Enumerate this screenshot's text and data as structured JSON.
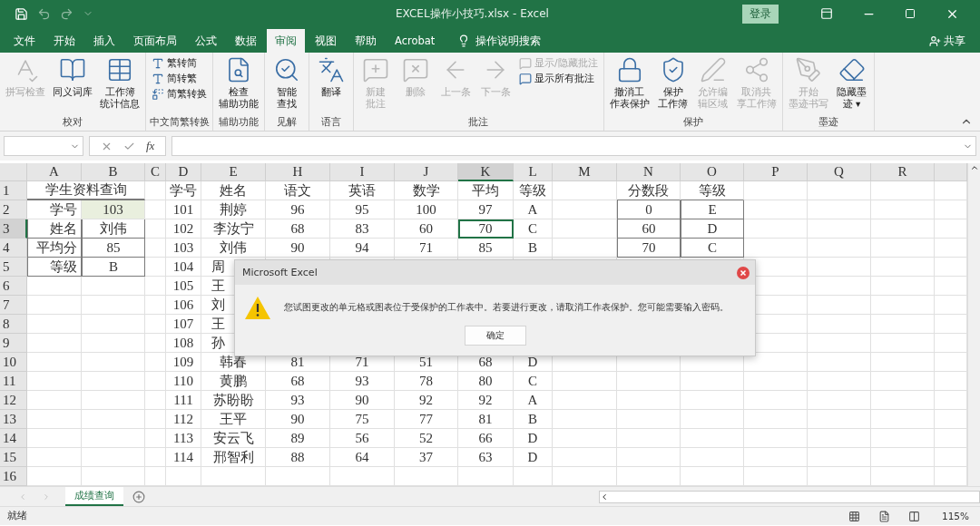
{
  "window": {
    "title": "EXCEL操作小技巧.xlsx  -  Excel",
    "login": "登录"
  },
  "menu_tabs": [
    {
      "label": "文件",
      "selected": false
    },
    {
      "label": "开始",
      "selected": false
    },
    {
      "label": "插入",
      "selected": false
    },
    {
      "label": "页面布局",
      "selected": false
    },
    {
      "label": "公式",
      "selected": false
    },
    {
      "label": "数据",
      "selected": false
    },
    {
      "label": "审阅",
      "selected": true
    },
    {
      "label": "视图",
      "selected": false
    },
    {
      "label": "帮助",
      "selected": false
    },
    {
      "label": "Acrobat",
      "selected": false
    }
  ],
  "tell_me": "操作说明搜索",
  "share": "共享",
  "ribbon": [
    {
      "label": "校对",
      "buttons": [
        {
          "kind": "large",
          "lines": [
            "拼写检查"
          ],
          "disabled": true
        },
        {
          "kind": "large",
          "lines": [
            "同义词库"
          ],
          "disabled": false
        },
        {
          "kind": "large",
          "lines": [
            "工作簿",
            "统计信息"
          ],
          "disabled": false
        }
      ]
    },
    {
      "label": "中文简繁转换",
      "buttons": [
        {
          "kind": "small",
          "lines": [
            "繁转简"
          ],
          "disabled": false
        },
        {
          "kind": "small",
          "lines": [
            "简转繁"
          ],
          "disabled": false
        },
        {
          "kind": "small",
          "lines": [
            "简繁转换"
          ],
          "disabled": false
        }
      ]
    },
    {
      "label": "辅助功能",
      "buttons": [
        {
          "kind": "large",
          "lines": [
            "检查",
            "辅助功能"
          ],
          "disabled": false
        }
      ]
    },
    {
      "label": "见解",
      "buttons": [
        {
          "kind": "large",
          "lines": [
            "智能",
            "查找"
          ],
          "disabled": false
        }
      ]
    },
    {
      "label": "语言",
      "buttons": [
        {
          "kind": "large",
          "lines": [
            "翻译"
          ],
          "disabled": false
        }
      ]
    },
    {
      "label": "批注",
      "buttons": [
        {
          "kind": "large",
          "lines": [
            "新建",
            "批注"
          ],
          "disabled": true
        },
        {
          "kind": "large",
          "lines": [
            "删除"
          ],
          "disabled": true
        },
        {
          "kind": "large",
          "lines": [
            "上一条"
          ],
          "disabled": true
        },
        {
          "kind": "large",
          "lines": [
            "下一条"
          ],
          "disabled": true
        },
        {
          "kind": "small",
          "lines": [
            "显示/隐藏批注"
          ],
          "disabled": true
        },
        {
          "kind": "small",
          "lines": [
            "显示所有批注"
          ],
          "disabled": false
        }
      ]
    },
    {
      "label": "保护",
      "buttons": [
        {
          "kind": "large",
          "lines": [
            "撤消工",
            "作表保护"
          ],
          "disabled": false
        },
        {
          "kind": "large",
          "lines": [
            "保护",
            "工作簿"
          ],
          "disabled": false
        },
        {
          "kind": "large",
          "lines": [
            "允许编",
            "辑区域"
          ],
          "disabled": true
        },
        {
          "kind": "large",
          "lines": [
            "取消共",
            "享工作簿"
          ],
          "disabled": true
        }
      ]
    },
    {
      "label": "墨迹",
      "buttons": [
        {
          "kind": "large",
          "lines": [
            "开始",
            "墨迹书写"
          ],
          "disabled": true
        },
        {
          "kind": "large",
          "lines": [
            "隐藏墨",
            "迹 ▾"
          ],
          "disabled": false
        }
      ]
    }
  ],
  "formula_bar": {
    "fx": "fx"
  },
  "columns": [
    {
      "label": "A",
      "selected": false
    },
    {
      "label": "B",
      "selected": false
    },
    {
      "label": "C",
      "selected": false
    },
    {
      "label": "D",
      "selected": false
    },
    {
      "label": "E",
      "selected": false
    },
    {
      "label": "H",
      "selected": false
    },
    {
      "label": "I",
      "selected": false
    },
    {
      "label": "J",
      "selected": false
    },
    {
      "label": "K",
      "selected": true
    },
    {
      "label": "L",
      "selected": false
    },
    {
      "label": "M",
      "selected": false
    },
    {
      "label": "N",
      "selected": false
    },
    {
      "label": "O",
      "selected": false
    },
    {
      "label": "P",
      "selected": false
    },
    {
      "label": "Q",
      "selected": false
    },
    {
      "label": "R",
      "selected": false
    }
  ],
  "rows": [
    {
      "number": "1",
      "selected": false,
      "cells": [
        {
          "text": "学生资料查询",
          "merged": true
        },
        null,
        null,
        "学号",
        "姓名",
        "语文",
        "英语",
        "数学",
        "平均",
        "等级",
        null,
        {
          "text": "分数段",
          "underlined": true
        },
        {
          "text": "等级",
          "underlined": true
        }
      ]
    },
    {
      "number": "2",
      "selected": false,
      "cells": [
        "学号",
        {
          "text": "103",
          "highlighted": true
        },
        null,
        "101",
        "荆婷",
        "96",
        "95",
        "100",
        "97",
        "A",
        null,
        {
          "text": "0",
          "bordered": true
        },
        {
          "text": "E",
          "bordered": true
        }
      ]
    },
    {
      "number": "3",
      "selected": true,
      "cells": [
        {
          "text": "姓名",
          "bordered": true
        },
        {
          "text": "刘伟",
          "bordered": true
        },
        null,
        "102",
        "李汝宁",
        "68",
        "83",
        "60",
        {
          "text": "70",
          "selected": true
        },
        "C",
        null,
        {
          "text": "60",
          "bordered": true
        },
        {
          "text": "D",
          "bordered": true
        }
      ]
    },
    {
      "number": "4",
      "selected": false,
      "cells": [
        {
          "text": "平均分",
          "bordered": true
        },
        {
          "text": "85",
          "bordered": true
        },
        null,
        "103",
        "刘伟",
        "90",
        "94",
        "71",
        "85",
        "B",
        null,
        {
          "text": "70",
          "bordered": true
        },
        {
          "text": "C",
          "bordered": true
        }
      ]
    },
    {
      "number": "5",
      "selected": false,
      "cells": [
        {
          "text": "等级",
          "bordered": true
        },
        {
          "text": "B",
          "bordered": true
        },
        null,
        "104",
        {
          "text": "周",
          "partial": true
        }
      ]
    },
    {
      "number": "6",
      "selected": false,
      "cells": [
        null,
        null,
        null,
        "105",
        {
          "text": "王",
          "partial": true
        }
      ]
    },
    {
      "number": "7",
      "selected": false,
      "cells": [
        null,
        null,
        null,
        "106",
        {
          "text": "刘",
          "partial": true
        }
      ]
    },
    {
      "number": "8",
      "selected": false,
      "cells": [
        null,
        null,
        null,
        "107",
        {
          "text": "王",
          "partial": true
        }
      ]
    },
    {
      "number": "9",
      "selected": false,
      "cells": [
        null,
        null,
        null,
        "108",
        {
          "text": "孙",
          "partial": true
        }
      ]
    },
    {
      "number": "10",
      "selected": false,
      "cells": [
        null,
        null,
        null,
        "109",
        "韩春",
        "81",
        "71",
        "51",
        "68",
        "D"
      ]
    },
    {
      "number": "11",
      "selected": false,
      "cells": [
        null,
        null,
        null,
        "110",
        "黄鹏",
        "68",
        "93",
        "78",
        "80",
        "C"
      ]
    },
    {
      "number": "12",
      "selected": false,
      "cells": [
        null,
        null,
        null,
        "111",
        "苏盼盼",
        "93",
        "90",
        "92",
        "92",
        "A"
      ]
    },
    {
      "number": "13",
      "selected": false,
      "cells": [
        null,
        null,
        null,
        "112",
        "王平",
        "90",
        "75",
        "77",
        "81",
        "B"
      ]
    },
    {
      "number": "14",
      "selected": false,
      "cells": [
        null,
        null,
        null,
        "113",
        "安云飞",
        "89",
        "56",
        "52",
        "66",
        "D"
      ]
    },
    {
      "number": "15",
      "selected": false,
      "cells": [
        null,
        null,
        null,
        "114",
        "邢智利",
        "88",
        "64",
        "37",
        "63",
        "D"
      ]
    },
    {
      "number": "16",
      "selected": false
    }
  ],
  "dialog": {
    "title": "Microsoft Excel",
    "message": "您试图更改的单元格或图表位于受保护的工作表中。若要进行更改，请取消工作表保护。您可能需要输入密码。",
    "button": "确定"
  },
  "sheet_tabs": [
    {
      "label": "成绩查询",
      "selected": true
    }
  ],
  "status_bar": {
    "status": "就绪",
    "zoom": "115%"
  }
}
